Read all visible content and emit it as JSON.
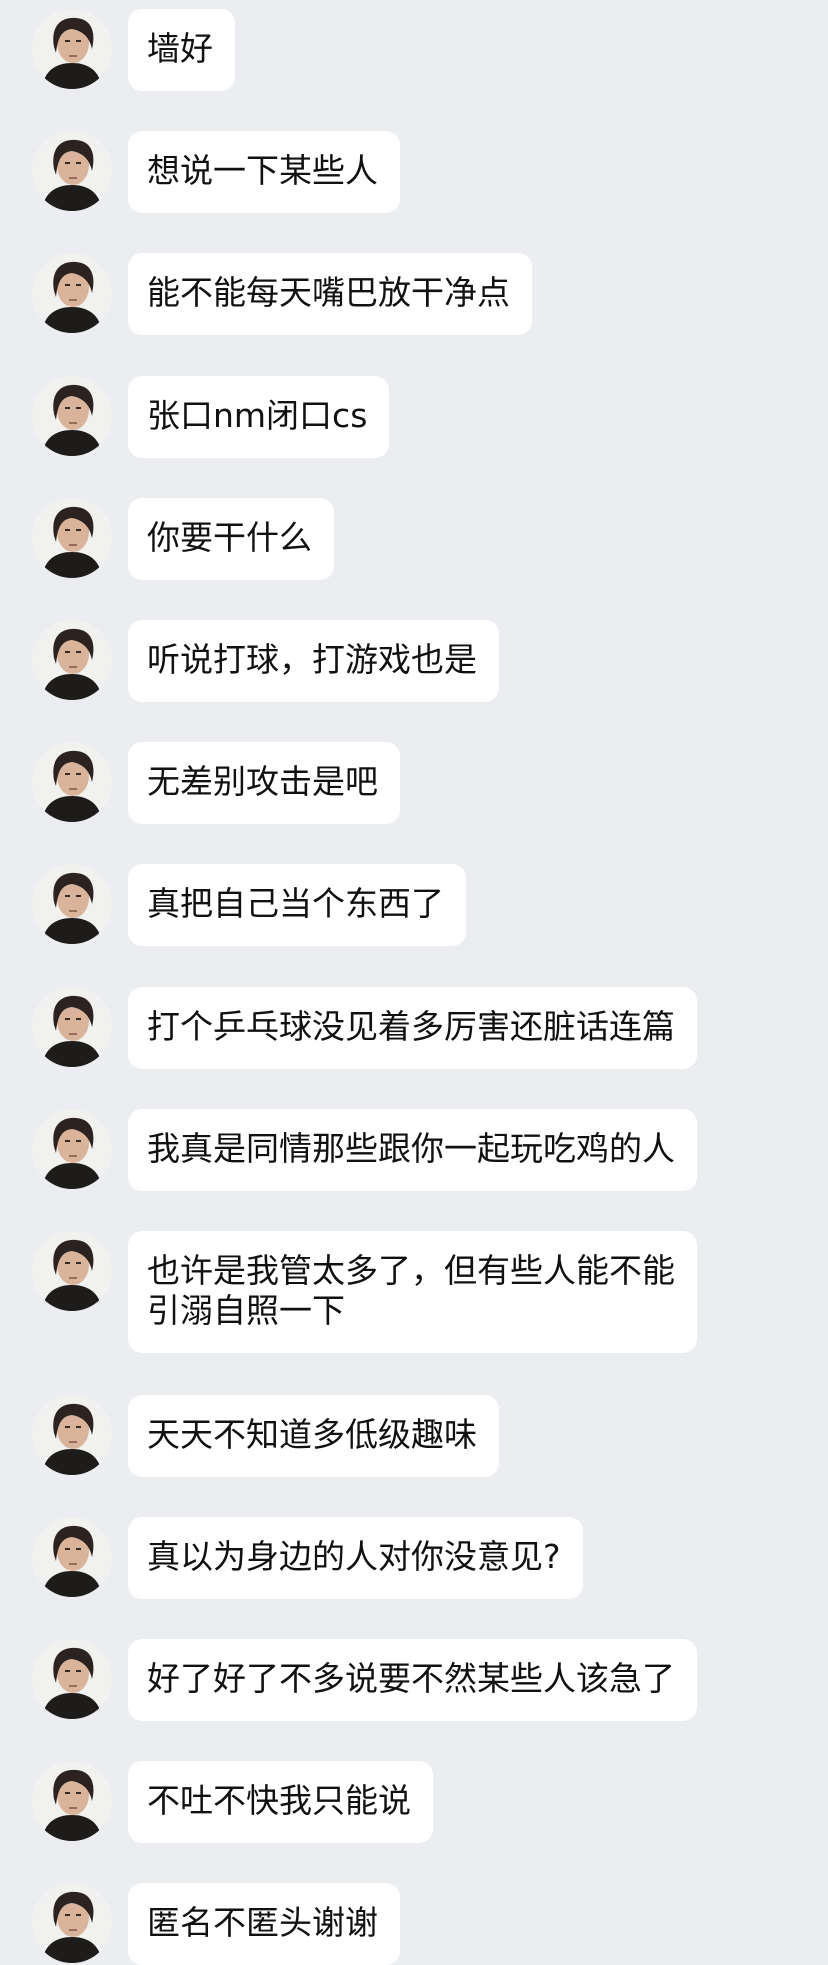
{
  "messages": [
    {
      "text": "墙好"
    },
    {
      "text": "想说一下某些人"
    },
    {
      "text": "能不能每天嘴巴放干净点"
    },
    {
      "text": "张口nm闭口cs"
    },
    {
      "text": "你要干什么"
    },
    {
      "text": "听说打球，打游戏也是"
    },
    {
      "text": "无差别攻击是吧"
    },
    {
      "text": "真把自己当个东西了"
    },
    {
      "text": "打个乒乓球没见着多厉害还脏话连篇"
    },
    {
      "text": "我真是同情那些跟你一起玩吃鸡的人"
    },
    {
      "text": "也许是我管太多了，但有些人能不能\n引溺自照一下"
    },
    {
      "text": "天天不知道多低级趣味"
    },
    {
      "text": "真以为身边的人对你没意见?"
    },
    {
      "text": "好了好了不多说要不然某些人该急了"
    },
    {
      "text": "不吐不快我只能说"
    },
    {
      "text": "匿名不匿头谢谢"
    }
  ],
  "colors": {
    "background": "#ebedf0",
    "bubble": "#ffffff",
    "text": "#111111"
  },
  "icons": {
    "avatar": "user-avatar-photo"
  }
}
